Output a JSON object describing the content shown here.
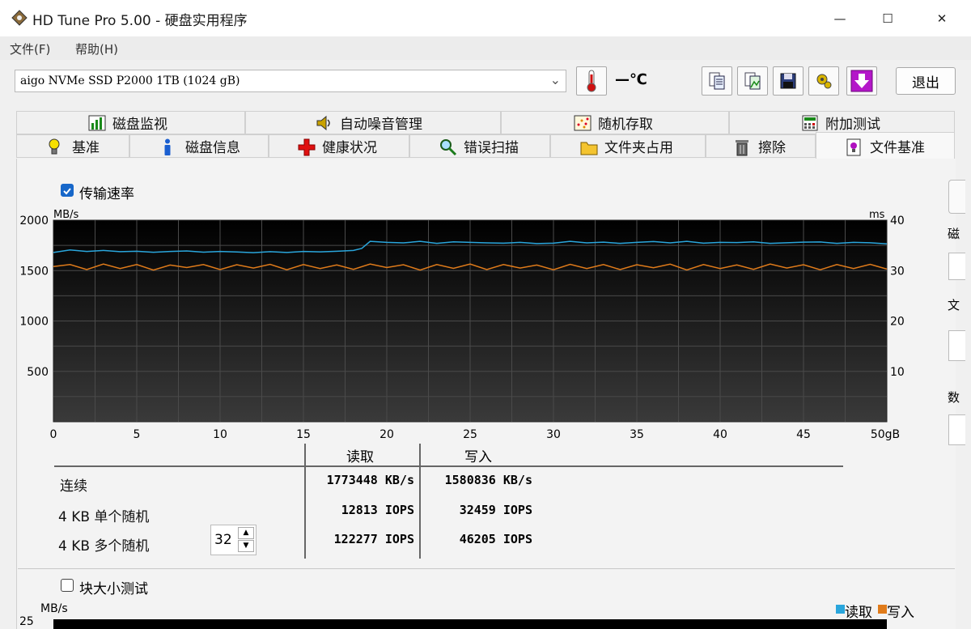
{
  "window": {
    "title": "HD Tune Pro 5.00 - 硬盘实用程序",
    "minimize": "—",
    "maximize": "☐",
    "close": "✕"
  },
  "menu": {
    "file": "文件(F)",
    "help": "帮助(H)"
  },
  "toolbar": {
    "drive": "aigo NVMe SSD P2000 1TB (1024 gB)",
    "temperature": "—℃",
    "exit_label": "退出",
    "icons": [
      "thermometer-icon",
      "copy-text-icon",
      "copy-image-icon",
      "save-icon",
      "settings-icon",
      "download-icon"
    ]
  },
  "tabs_row1": [
    {
      "label": "磁盘监视",
      "icon": "chart-icon"
    },
    {
      "label": "自动噪音管理",
      "icon": "speaker-icon"
    },
    {
      "label": "随机存取",
      "icon": "scatter-icon"
    },
    {
      "label": "附加测试",
      "icon": "calculator-icon"
    }
  ],
  "tabs_row2": [
    {
      "label": "基准",
      "icon": "bulb-icon"
    },
    {
      "label": "磁盘信息",
      "icon": "info-icon"
    },
    {
      "label": "健康状况",
      "icon": "health-cross-icon"
    },
    {
      "label": "错误扫描",
      "icon": "magnifier-icon"
    },
    {
      "label": "文件夹占用",
      "icon": "folder-icon"
    },
    {
      "label": "擦除",
      "icon": "trash-icon"
    },
    {
      "label": "文件基准",
      "icon": "file-benchmark-icon"
    }
  ],
  "transfer_checkbox": {
    "label": "传输速率",
    "checked": true
  },
  "block_checkbox": {
    "label": "块大小测试",
    "checked": false
  },
  "colors": {
    "read": "#2aa6dc",
    "write": "#e07b1a",
    "plot_bg": "#000000",
    "grid": "#4a4a4a"
  },
  "chart_data": {
    "type": "line",
    "x_unit": "gB",
    "xlim": [
      0,
      50
    ],
    "x_ticks": [
      "0",
      "5",
      "10",
      "15",
      "20",
      "25",
      "30",
      "35",
      "40",
      "45",
      "50gB"
    ],
    "y_left_label": "MB/s",
    "y_left_lim": [
      0,
      2000
    ],
    "y_left_ticks": [
      "2000",
      "1500",
      "1000",
      "500"
    ],
    "y_right_label": "ms",
    "y_right_lim": [
      0,
      40
    ],
    "y_right_ticks": [
      "40",
      "30",
      "20",
      "10"
    ],
    "series": [
      {
        "name": "读取",
        "color": "#2aa6dc",
        "x": [
          0,
          1,
          2,
          3,
          4,
          5,
          6,
          7,
          8,
          9,
          10,
          11,
          12,
          13,
          14,
          15,
          16,
          17,
          18,
          18.5,
          19,
          20,
          21,
          22,
          23,
          24,
          25,
          26,
          27,
          28,
          29,
          30,
          31,
          32,
          33,
          34,
          35,
          36,
          37,
          38,
          39,
          40,
          41,
          42,
          43,
          44,
          45,
          46,
          47,
          48,
          49,
          50
        ],
        "values": [
          1680,
          1705,
          1690,
          1700,
          1688,
          1692,
          1682,
          1690,
          1695,
          1683,
          1690,
          1685,
          1678,
          1688,
          1680,
          1690,
          1686,
          1692,
          1700,
          1720,
          1790,
          1780,
          1775,
          1790,
          1770,
          1785,
          1780,
          1775,
          1772,
          1780,
          1768,
          1772,
          1790,
          1775,
          1782,
          1770,
          1780,
          1788,
          1775,
          1790,
          1772,
          1780,
          1778,
          1785,
          1770,
          1776,
          1782,
          1784,
          1770,
          1780,
          1776,
          1765
        ]
      },
      {
        "name": "写入",
        "color": "#e07b1a",
        "x": [
          0,
          1,
          2,
          3,
          4,
          5,
          6,
          7,
          8,
          9,
          10,
          11,
          12,
          13,
          14,
          15,
          16,
          17,
          18,
          19,
          20,
          21,
          22,
          23,
          24,
          25,
          26,
          27,
          28,
          29,
          30,
          31,
          32,
          33,
          34,
          35,
          36,
          37,
          38,
          39,
          40,
          41,
          42,
          43,
          44,
          45,
          46,
          47,
          48,
          49,
          50
        ],
        "values": [
          1540,
          1560,
          1510,
          1565,
          1520,
          1560,
          1505,
          1555,
          1530,
          1560,
          1510,
          1558,
          1525,
          1562,
          1508,
          1560,
          1520,
          1556,
          1512,
          1565,
          1530,
          1558,
          1505,
          1560,
          1522,
          1565,
          1510,
          1560,
          1525,
          1555,
          1508,
          1562,
          1520,
          1560,
          1510,
          1558,
          1528,
          1564,
          1506,
          1560,
          1520,
          1556,
          1512,
          1565,
          1525,
          1558,
          1508,
          1560,
          1520,
          1562,
          1515
        ]
      }
    ]
  },
  "results": {
    "read_header": "读取",
    "write_header": "写入",
    "rows": [
      {
        "label": "连续",
        "read": "1773448 KB/s",
        "write": "1580836 KB/s"
      },
      {
        "label": "4 KB 单个随机",
        "read": "12813 IOPS",
        "write": "32459 IOPS"
      },
      {
        "label": "4 KB 多个随机",
        "read": "122277 IOPS",
        "write": "46205 IOPS"
      }
    ],
    "queue_depth": "32"
  },
  "bottom_chart": {
    "y_label": "MB/s",
    "y_top": "25",
    "legend_read": "读取",
    "legend_write": "写入"
  },
  "right_cut": [
    "磁",
    "文",
    "数"
  ]
}
